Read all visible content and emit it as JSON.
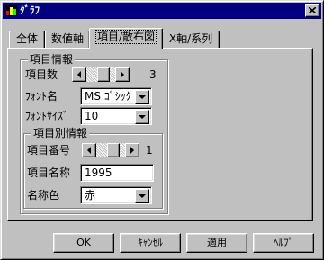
{
  "window": {
    "title": "ｸﾞﾗﾌ",
    "close_icon": "close-icon",
    "app_icon": "chart-icon"
  },
  "tabs": [
    {
      "label": "全体",
      "active": false
    },
    {
      "label": "数値軸",
      "active": false
    },
    {
      "label": "項目/散布図",
      "active": true
    },
    {
      "label": "X軸/系列",
      "active": false
    }
  ],
  "item_info": {
    "group_label": "項目情報",
    "count_label": "項目数",
    "count_value": "3",
    "font_name_label": "ﾌｫﾝﾄ名",
    "font_name_value": "MS ｺﾞｼｯｸ",
    "font_size_label": "ﾌｫﾝﾄｻｲｽﾞ",
    "font_size_value": "10"
  },
  "item_detail": {
    "group_label": "項目別情報",
    "number_label": "項目番号",
    "number_value": "1",
    "name_label": "項目名称",
    "name_value": "1995",
    "color_label": "名称色",
    "color_value": "赤"
  },
  "buttons": {
    "ok": "OK",
    "cancel": "ｷｬﾝｾﾙ",
    "apply": "適用",
    "help": "ﾍﾙﾌﾟ"
  }
}
